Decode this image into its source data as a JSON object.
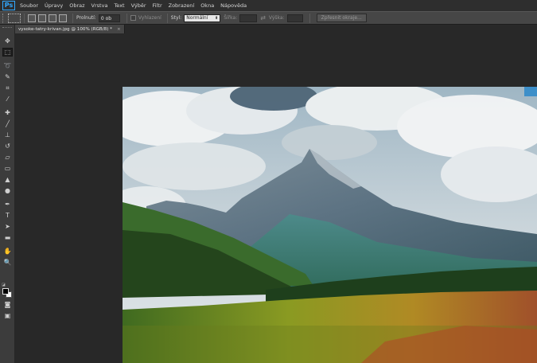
{
  "app": {
    "logo": "Ps",
    "accent": "#31a8ff"
  },
  "menu": [
    "Soubor",
    "Úpravy",
    "Obraz",
    "Vrstva",
    "Text",
    "Výběr",
    "Filtr",
    "Zobrazení",
    "Okna",
    "Nápověda"
  ],
  "options": {
    "feather_label": "Prolnutí:",
    "feather_value": "0 ob",
    "antialias_label": "Vyhlazení",
    "style_label": "Styl:",
    "style_value": "Normální",
    "width_label": "Šířka:",
    "height_label": "Výška:",
    "refine_button": "Zpřesnit okraje..."
  },
  "document": {
    "tab_title": "vysoke-tatry-krivan.jpg @ 100% (RGB/8) *",
    "close_glyph": "×"
  },
  "tools": [
    {
      "name": "move-tool-icon",
      "glyph": "✥"
    },
    {
      "name": "marquee-tool-icon",
      "glyph": "⬚",
      "active": true
    },
    {
      "name": "lasso-tool-icon",
      "glyph": "➰"
    },
    {
      "name": "quick-select-tool-icon",
      "glyph": "✎"
    },
    {
      "name": "crop-tool-icon",
      "glyph": "⌗"
    },
    {
      "name": "eyedropper-tool-icon",
      "glyph": "⁄"
    },
    {
      "name": "healing-brush-tool-icon",
      "glyph": "✚"
    },
    {
      "name": "brush-tool-icon",
      "glyph": "╱"
    },
    {
      "name": "clone-stamp-tool-icon",
      "glyph": "⊥"
    },
    {
      "name": "history-brush-tool-icon",
      "glyph": "↺"
    },
    {
      "name": "eraser-tool-icon",
      "glyph": "▱"
    },
    {
      "name": "gradient-tool-icon",
      "glyph": "▭"
    },
    {
      "name": "blur-tool-icon",
      "glyph": "▲"
    },
    {
      "name": "dodge-tool-icon",
      "glyph": "●"
    },
    {
      "name": "pen-tool-icon",
      "glyph": "✒"
    },
    {
      "name": "type-tool-icon",
      "glyph": "T"
    },
    {
      "name": "path-select-tool-icon",
      "glyph": "➤"
    },
    {
      "name": "shape-tool-icon",
      "glyph": "▬"
    },
    {
      "name": "hand-tool-icon",
      "glyph": "✋"
    },
    {
      "name": "zoom-tool-icon",
      "glyph": "🔍"
    }
  ],
  "bottom_tools": [
    {
      "name": "quick-mask-icon",
      "glyph": "◙"
    },
    {
      "name": "screen-mode-icon",
      "glyph": "▣"
    }
  ],
  "colors": {
    "foreground": "#000000",
    "background": "#ffffff"
  }
}
